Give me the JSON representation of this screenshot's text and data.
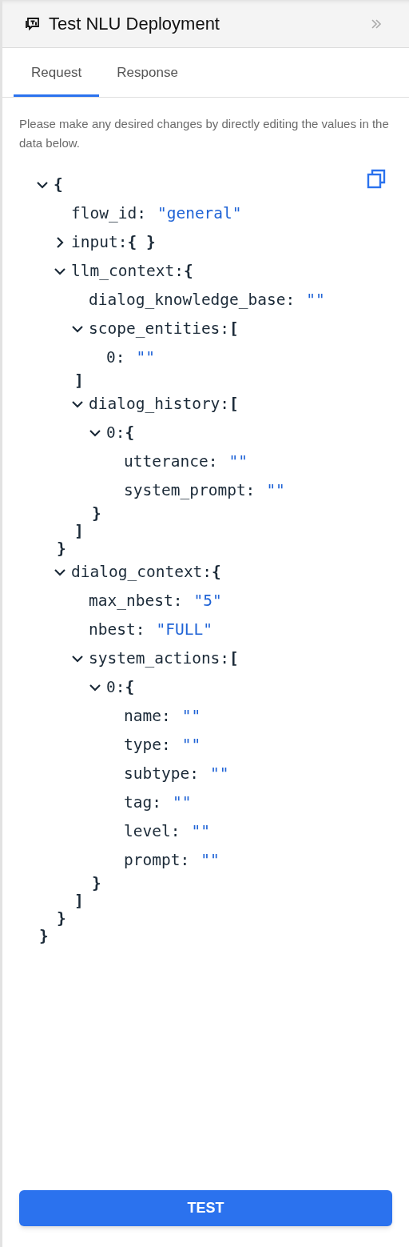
{
  "header": {
    "title": "Test NLU Deployment"
  },
  "tabs": [
    {
      "label": "Request",
      "selected": true
    },
    {
      "label": "Response",
      "selected": false
    }
  ],
  "instructions": "Please make any desired changes by directly editing the values in the data below.",
  "tree": {
    "kind": "branch",
    "open": "{",
    "close": "}",
    "expanded": true,
    "children": [
      {
        "kind": "field",
        "key": "flow_id:",
        "value": "\"general\""
      },
      {
        "kind": "branch",
        "key": "input:",
        "open": "{ }",
        "expanded": false
      },
      {
        "kind": "branch",
        "key": "llm_context:",
        "open": "{",
        "close": "}",
        "expanded": true,
        "children": [
          {
            "kind": "field",
            "key": "dialog_knowledge_base:",
            "value": "\"\""
          },
          {
            "kind": "branch",
            "key": "scope_entities:",
            "open": "[",
            "close": "]",
            "expanded": true,
            "children": [
              {
                "kind": "field",
                "key": "0:",
                "value": "\"\""
              }
            ]
          },
          {
            "kind": "branch",
            "key": "dialog_history:",
            "open": "[",
            "close": "]",
            "expanded": true,
            "children": [
              {
                "kind": "branch",
                "key": "0:",
                "open": "{",
                "close": "}",
                "expanded": true,
                "children": [
                  {
                    "kind": "field",
                    "key": "utterance:",
                    "value": "\"\""
                  },
                  {
                    "kind": "field",
                    "key": "system_prompt:",
                    "value": "\"\""
                  }
                ]
              }
            ]
          }
        ]
      },
      {
        "kind": "branch",
        "key": "dialog_context:",
        "open": "{",
        "close": "}",
        "expanded": true,
        "children": [
          {
            "kind": "field",
            "key": "max_nbest:",
            "value": "\"5\""
          },
          {
            "kind": "field",
            "key": "nbest:",
            "value": "\"FULL\""
          },
          {
            "kind": "branch",
            "key": "system_actions:",
            "open": "[",
            "close": "]",
            "expanded": true,
            "children": [
              {
                "kind": "branch",
                "key": "0:",
                "open": "{",
                "close": "}",
                "expanded": true,
                "children": [
                  {
                    "kind": "field",
                    "key": "name:",
                    "value": "\"\""
                  },
                  {
                    "kind": "field",
                    "key": "type:",
                    "value": "\"\""
                  },
                  {
                    "kind": "field",
                    "key": "subtype:",
                    "value": "\"\""
                  },
                  {
                    "kind": "field",
                    "key": "tag:",
                    "value": "\"\""
                  },
                  {
                    "kind": "field",
                    "key": "level:",
                    "value": "\"\""
                  },
                  {
                    "kind": "field",
                    "key": "prompt:",
                    "value": "\"\""
                  }
                ]
              }
            ]
          }
        ]
      }
    ]
  },
  "button": "TEST"
}
